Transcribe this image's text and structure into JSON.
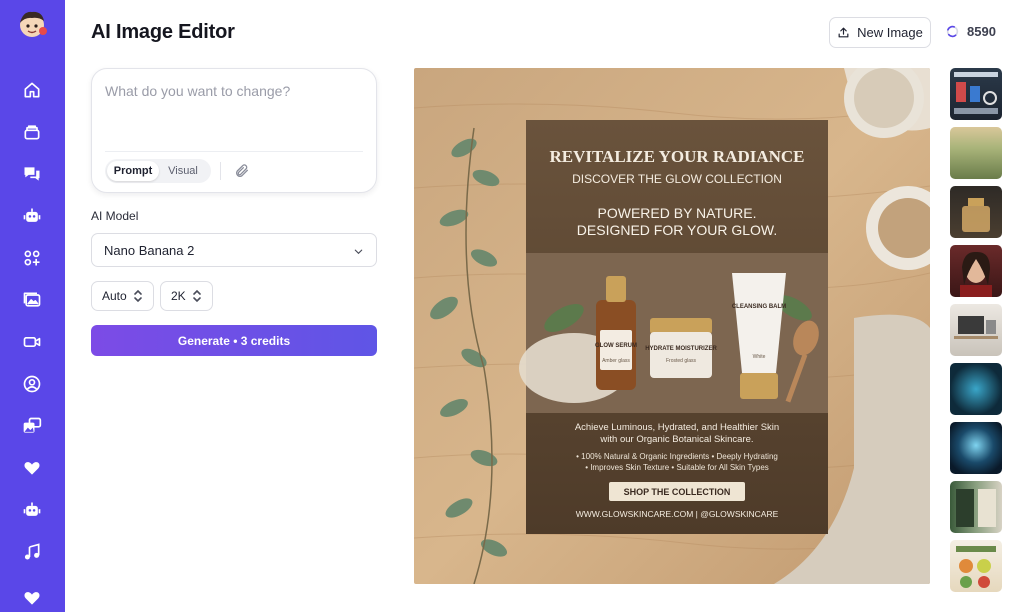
{
  "app": {
    "title": "AI Image Editor"
  },
  "header": {
    "new_image_label": "New Image",
    "credits_count": "8590"
  },
  "sidebar": {
    "items": [
      {
        "icon": "home-icon"
      },
      {
        "icon": "layers-icon"
      },
      {
        "icon": "chat-icon"
      },
      {
        "icon": "robot-icon"
      },
      {
        "icon": "apps-icon"
      },
      {
        "icon": "gallery-icon"
      },
      {
        "icon": "video-icon"
      },
      {
        "icon": "user-circle-icon"
      },
      {
        "icon": "images-icon"
      },
      {
        "icon": "heart-icon"
      },
      {
        "icon": "robot-icon"
      },
      {
        "icon": "music-icon"
      },
      {
        "icon": "heart-icon"
      }
    ]
  },
  "prompt": {
    "placeholder": "What do you want to change?",
    "value": "",
    "modes": [
      "Prompt",
      "Visual"
    ],
    "active_mode": "Prompt"
  },
  "model": {
    "label": "AI Model",
    "selected": "Nano Banana 2"
  },
  "options": {
    "aspect": "Auto",
    "resolution": "2K"
  },
  "generate": {
    "label": "Generate • 3 credits"
  },
  "poster": {
    "title": "REVITALIZE YOUR RADIANCE",
    "subtitle": "DISCOVER THE GLOW COLLECTION",
    "tagline_1": "POWERED BY NATURE.",
    "tagline_2": "DESIGNED FOR YOUR GLOW.",
    "product_1": "GLOW SERUM",
    "product_1_sub": "Amber glass",
    "product_2": "HYDRATE MOISTURIZER",
    "product_2_sub": "Frosted glass",
    "product_3": "CLEANSING BALM",
    "product_3_sub": "White",
    "body_1": "Achieve Luminous, Hydrated, and Healthier Skin",
    "body_2": "with our Organic Botanical Skincare.",
    "bullets_1": "• 100% Natural & Organic Ingredients  • Deeply Hydrating",
    "bullets_2": "• Improves Skin Texture    • Suitable for All Skin Types",
    "cta": "SHOP THE COLLECTION",
    "footer": "WWW.GLOWSKINCARE.COM | @GLOWSKINCARE"
  },
  "colors": {
    "sidebar": "#5a47e8",
    "accent_start": "#7c4be6",
    "accent_end": "#5f55e6",
    "poster_bg": "#5b4631"
  },
  "thumbnails": [
    {
      "name": "infographic"
    },
    {
      "name": "landscape-hills"
    },
    {
      "name": "perfume-bottle"
    },
    {
      "name": "portrait-woman"
    },
    {
      "name": "desk-setup"
    },
    {
      "name": "tech-circuit"
    },
    {
      "name": "tech-brain"
    },
    {
      "name": "book-covers"
    },
    {
      "name": "magazine-layout"
    }
  ]
}
